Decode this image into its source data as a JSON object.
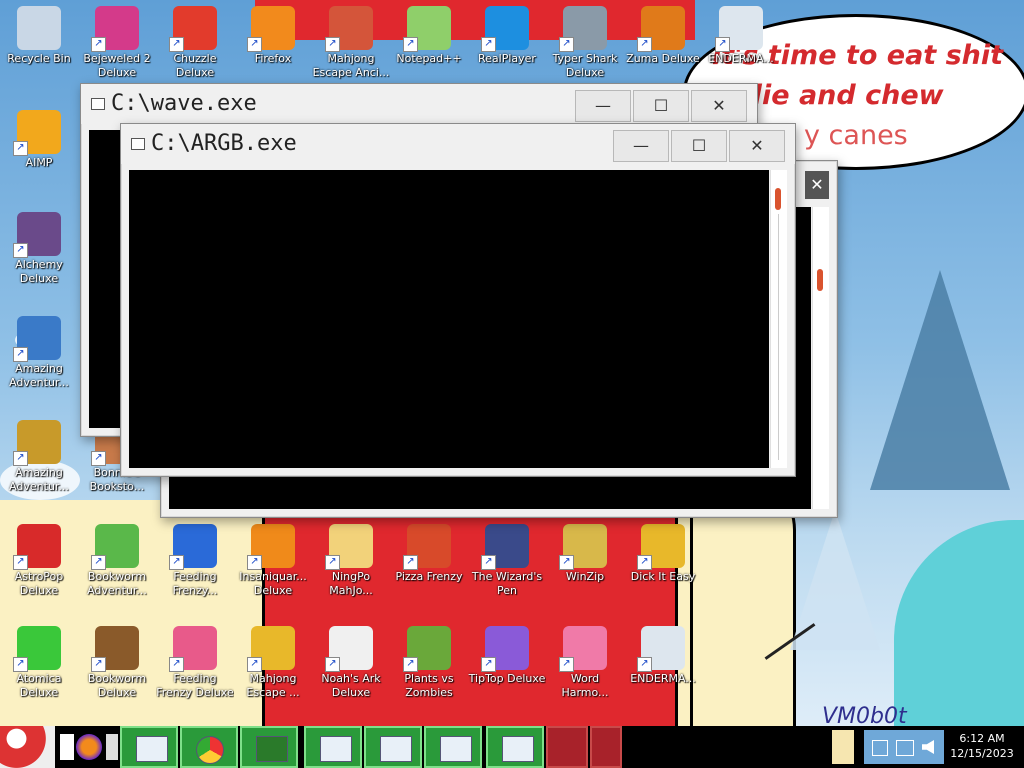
{
  "wallpaper": {
    "bubble_lines": [
      "it's time to eat shit",
      "l die and chew",
      "y canes"
    ],
    "signature": "VM0b0t"
  },
  "icons": [
    {
      "label": "Recycle Bin",
      "icon": "recycle-bin-icon",
      "color": "#c9d7e6"
    },
    {
      "label": "Bejeweled 2 Deluxe",
      "icon": "bejeweled-icon",
      "color": "#d43a8a"
    },
    {
      "label": "Chuzzle Deluxe",
      "icon": "chuzzle-icon",
      "color": "#e23b2c"
    },
    {
      "label": "Firefox",
      "icon": "firefox-icon",
      "color": "#f28a1c"
    },
    {
      "label": "Mahjong Escape Anci...",
      "icon": "mahjong-gate-icon",
      "color": "#d4553a"
    },
    {
      "label": "Notepad++",
      "icon": "notepadpp-icon",
      "color": "#8fcf6a"
    },
    {
      "label": "RealPlayer",
      "icon": "realplayer-icon",
      "color": "#1d8fe0"
    },
    {
      "label": "Typer Shark Deluxe",
      "icon": "shark-icon",
      "color": "#8a9aa8"
    },
    {
      "label": "Zuma Deluxe",
      "icon": "zuma-icon",
      "color": "#e07a1a"
    },
    {
      "label": "ENDERMA...",
      "icon": "window-file-icon",
      "color": "#dde6ee"
    },
    {
      "label": "AIMP",
      "icon": "aimp-icon",
      "color": "#f2a81c"
    },
    {
      "label": "Alchemy Deluxe",
      "icon": "wizard-icon",
      "color": "#6a4a8a"
    },
    {
      "label": "Amazing Adventur...",
      "icon": "compass-gem-icon",
      "color": "#3a7ac8"
    },
    {
      "label": "Amazing Adventur...",
      "icon": "globe-compass-icon",
      "color": "#c89a2a"
    },
    {
      "label": "Bonnie's Bookstо...",
      "icon": "bonnie-icon",
      "color": "#c87a4a"
    },
    {
      "label": "AstroPop Deluxe",
      "icon": "astropop-icon",
      "color": "#d82a2a"
    },
    {
      "label": "Bookworm Adventur...",
      "icon": "bookworm-icon",
      "color": "#5ab84a"
    },
    {
      "label": "Feeding Frenzy...",
      "icon": "fish-blue-icon",
      "color": "#2a6ad8"
    },
    {
      "label": "Insaniquar... Deluxe",
      "icon": "fish-orange-icon",
      "color": "#f08a1a"
    },
    {
      "label": "NingPo MahJo...",
      "icon": "ningpo-icon",
      "color": "#f2d27a"
    },
    {
      "label": "Pizza Frenzy",
      "icon": "pizza-icon",
      "color": "#d84a2a"
    },
    {
      "label": "The Wizard's Pen",
      "icon": "wizard-pen-icon",
      "color": "#3a4a8a"
    },
    {
      "label": "WinZip",
      "icon": "winzip-icon",
      "color": "#d8b84a"
    },
    {
      "label": "Dick It Easy",
      "icon": "de-icon",
      "color": "#e8b82a"
    },
    {
      "label": "Atomica Deluxe",
      "icon": "atomica-icon",
      "color": "#3ac83a"
    },
    {
      "label": "Bookworm Deluxe",
      "icon": "bookworm-book-icon",
      "color": "#8a5a2a"
    },
    {
      "label": "Feeding Frenzy Deluxe",
      "icon": "fish-pink-icon",
      "color": "#e85a8a"
    },
    {
      "label": "Mahjong Escape ...",
      "icon": "mahjong-tile-icon",
      "color": "#e8b82a"
    },
    {
      "label": "Noah's Ark Deluxe",
      "icon": "dove-icon",
      "color": "#f0f0f0"
    },
    {
      "label": "Plants vs Zombies",
      "icon": "pvz-icon",
      "color": "#6aa83a"
    },
    {
      "label": "TipTop Deluxe",
      "icon": "cocktail-icon",
      "color": "#8a5ad8"
    },
    {
      "label": "Word Harmo...",
      "icon": "flower-icon",
      "color": "#f07aa8"
    },
    {
      "label": "ENDERMA...",
      "icon": "window-file-icon",
      "color": "#dde6ee"
    }
  ],
  "windows": {
    "back": {
      "title": "C:\\wave.exe"
    },
    "front": {
      "title": "C:\\ARGB.exe"
    },
    "buttons": {
      "minimize": "—",
      "maximize": "☐",
      "close": "✕"
    }
  },
  "taskbar": {
    "tasks": [
      "File Explorer",
      "Chrome",
      "Tree app",
      "Window",
      "Window",
      "Window",
      "Window"
    ],
    "clock_time": "6:12 AM",
    "clock_date": "12/15/2023"
  }
}
